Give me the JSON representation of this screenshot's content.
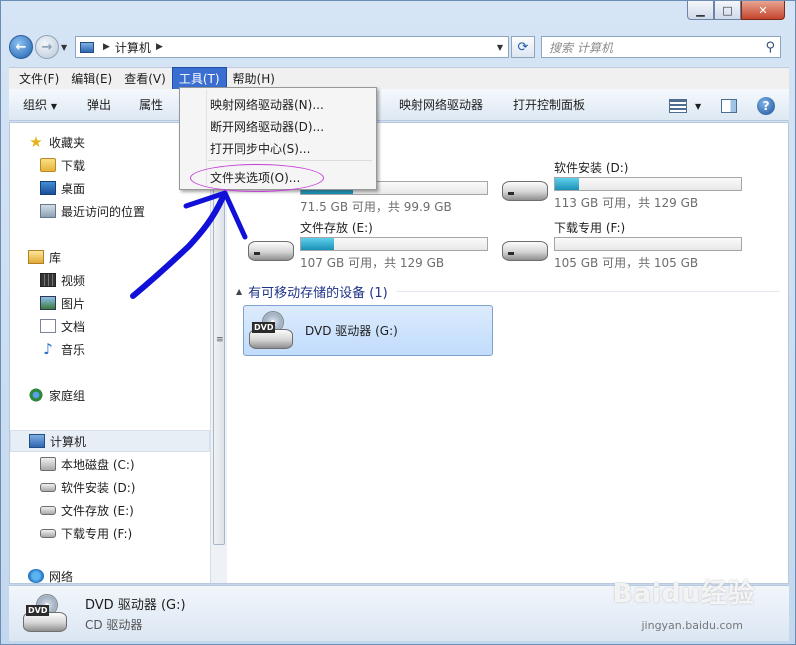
{
  "window": {
    "title": "计算机"
  },
  "address": {
    "crumb": "计算机"
  },
  "search": {
    "placeholder": "搜索 计算机"
  },
  "menubar": [
    "文件(F)",
    "编辑(E)",
    "查看(V)",
    "工具(T)",
    "帮助(H)"
  ],
  "tools_menu": [
    "映射网络驱动器(N)...",
    "断开网络驱动器(D)...",
    "打开同步中心(S)...",
    "文件夹选项(O)..."
  ],
  "toolbar": {
    "organize": "组织",
    "eject": "弹出",
    "properties": "属性",
    "map_drive": "映射网络驱动器",
    "control_panel": "打开控制面板"
  },
  "nav": {
    "favorites": "收藏夹",
    "downloads": "下载",
    "desktop": "桌面",
    "recent": "最近访问的位置",
    "libraries": "库",
    "videos": "视频",
    "pictures": "图片",
    "documents": "文档",
    "music": "音乐",
    "homegroup": "家庭组",
    "computer": "计算机",
    "drive_c": "本地磁盘 (C:)",
    "drive_d": "软件安装 (D:)",
    "drive_e": "文件存放 (E:)",
    "drive_f": "下载专用 (F:)",
    "network": "网络"
  },
  "drives": [
    {
      "name": "",
      "free": "71.5 GB 可用，共 99.9 GB",
      "used_fraction": 0.28
    },
    {
      "name": "软件安装 (D:)",
      "free": "113 GB 可用，共 129 GB",
      "used_fraction": 0.13
    },
    {
      "name": "文件存放 (E:)",
      "free": "107 GB 可用，共 129 GB",
      "used_fraction": 0.18
    },
    {
      "name": "下载专用 (F:)",
      "free": "105 GB 可用，共 105 GB",
      "used_fraction": 0.0
    }
  ],
  "removable": {
    "header": "有可移动存储的设备 (1)",
    "dvd_name": "DVD 驱动器 (G:)",
    "dvd_tag": "DVD"
  },
  "details": {
    "title": "DVD 驱动器 (G:)",
    "subtitle": "CD 驱动器",
    "tag": "DVD"
  },
  "watermark": {
    "brand": "Baidu经验",
    "url": "jingyan.baidu.com"
  },
  "colors": {
    "menu_highlight": "#3a6ed0",
    "annotation_oval": "#c63fd9",
    "annotation_arrow": "#1010d8",
    "drive_bar": "#1a91b8"
  }
}
